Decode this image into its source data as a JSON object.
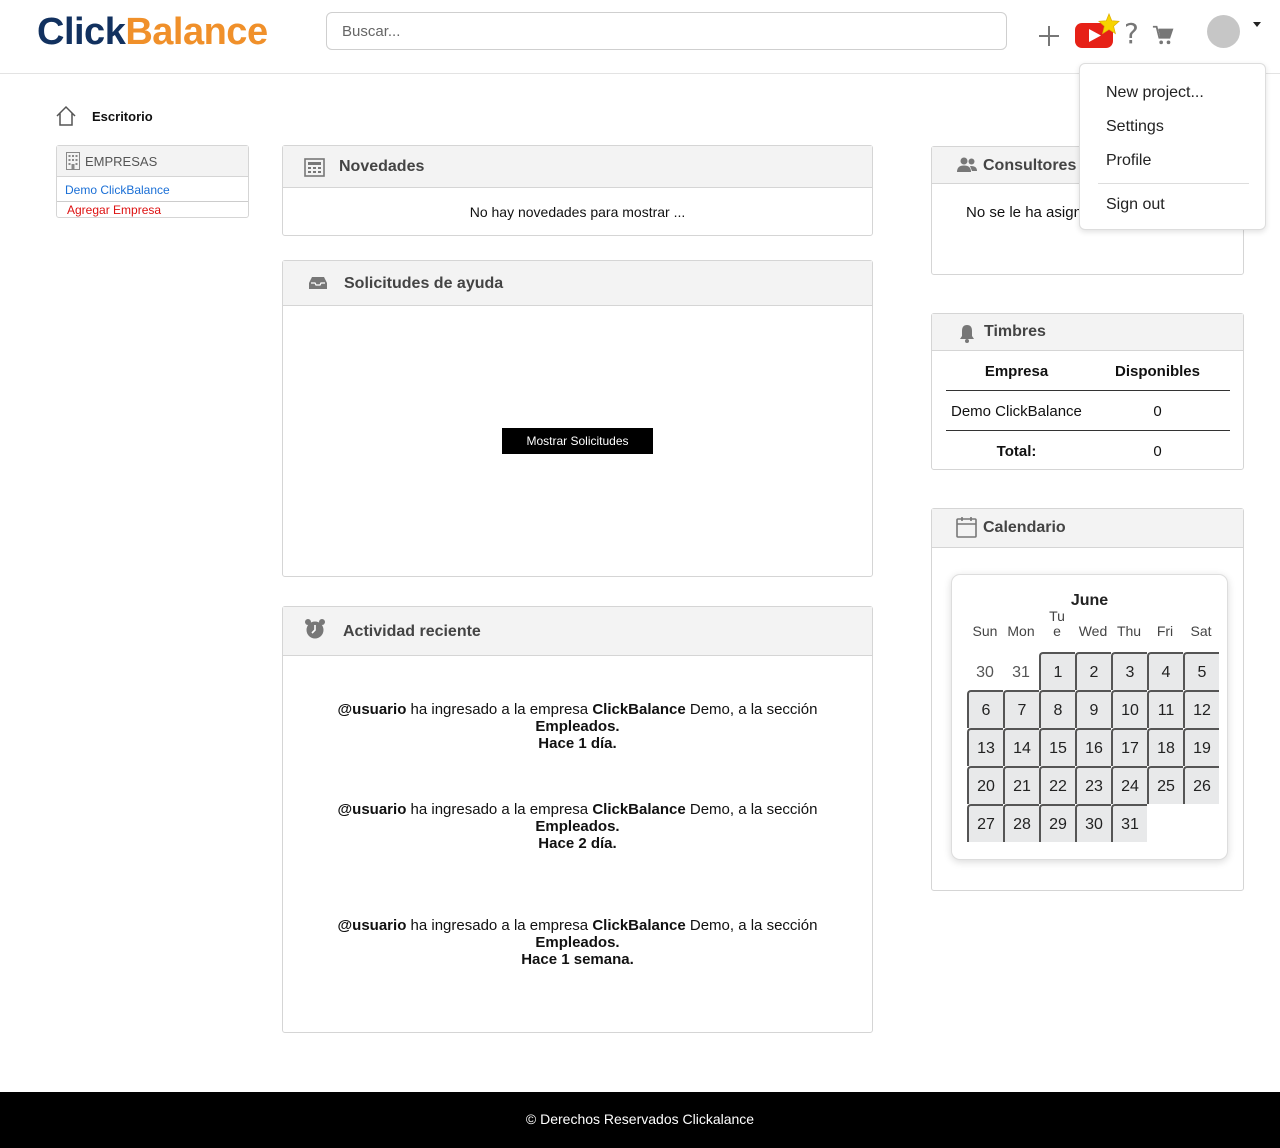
{
  "brand": {
    "part1": "Click",
    "part2": "Balance"
  },
  "search": {
    "placeholder": "Buscar..."
  },
  "header_icons": {
    "add": "plus-icon",
    "video": "youtube-icon",
    "favorite": "star-icon",
    "help": "?",
    "cart": "cart-icon"
  },
  "user_menu": {
    "items": [
      "New project...",
      "Settings",
      "Profile",
      "Sign out"
    ]
  },
  "breadcrumb": {
    "current": "Escritorio"
  },
  "empresas": {
    "title": "EMPRESAS",
    "company": "Demo ClickBalance",
    "add": "Agregar Empresa"
  },
  "novedades": {
    "title": "Novedades",
    "empty": "No hay novedades para mostrar ..."
  },
  "solicitudes": {
    "title": "Solicitudes de ayuda",
    "button": "Mostrar Solicitudes"
  },
  "actividad": {
    "title": "Actividad reciente",
    "items": [
      {
        "user": "@usuario",
        "t1": " ha ingresado a la empresa ",
        "company": "ClickBalance",
        "t2": " Demo, a la sección",
        "section": "Empleados.",
        "time": "Hace 1 día."
      },
      {
        "user": "@usuario",
        "t1": " ha ingresado a la empresa ",
        "company": "ClickBalance",
        "t2": " Demo, a la sección",
        "section": "Empleados.",
        "time": "Hace 2 día."
      },
      {
        "user": "@usuario",
        "t1": " ha ingresado a la empresa ",
        "company": "ClickBalance",
        "t2": " Demo, a la sección",
        "section": "Empleados.",
        "time": "Hace 1 semana."
      }
    ]
  },
  "consultores": {
    "title": "Consultores",
    "message": "No se le ha asign"
  },
  "timbres": {
    "title": "Timbres",
    "col1": "Empresa",
    "col2": "Disponibles",
    "row_company": "Demo ClickBalance",
    "row_value": "0",
    "total_label": "Total:",
    "total_value": "0"
  },
  "calendario": {
    "title": "Calendario",
    "month": "June",
    "weekdays": [
      "Sun",
      "Mon",
      "Tu\ne",
      "Wed",
      "Thu",
      "Fri",
      "Sat"
    ],
    "leading_days": [
      "30",
      "31"
    ],
    "days_in_month": 31
  },
  "footer": {
    "text": "© Derechos Reservados Clickalance"
  },
  "colors": {
    "brand_dark": "#12315f",
    "brand_orange": "#f0902a",
    "link": "#1a6fd6",
    "danger": "#dd1111",
    "youtube": "#e62117"
  }
}
